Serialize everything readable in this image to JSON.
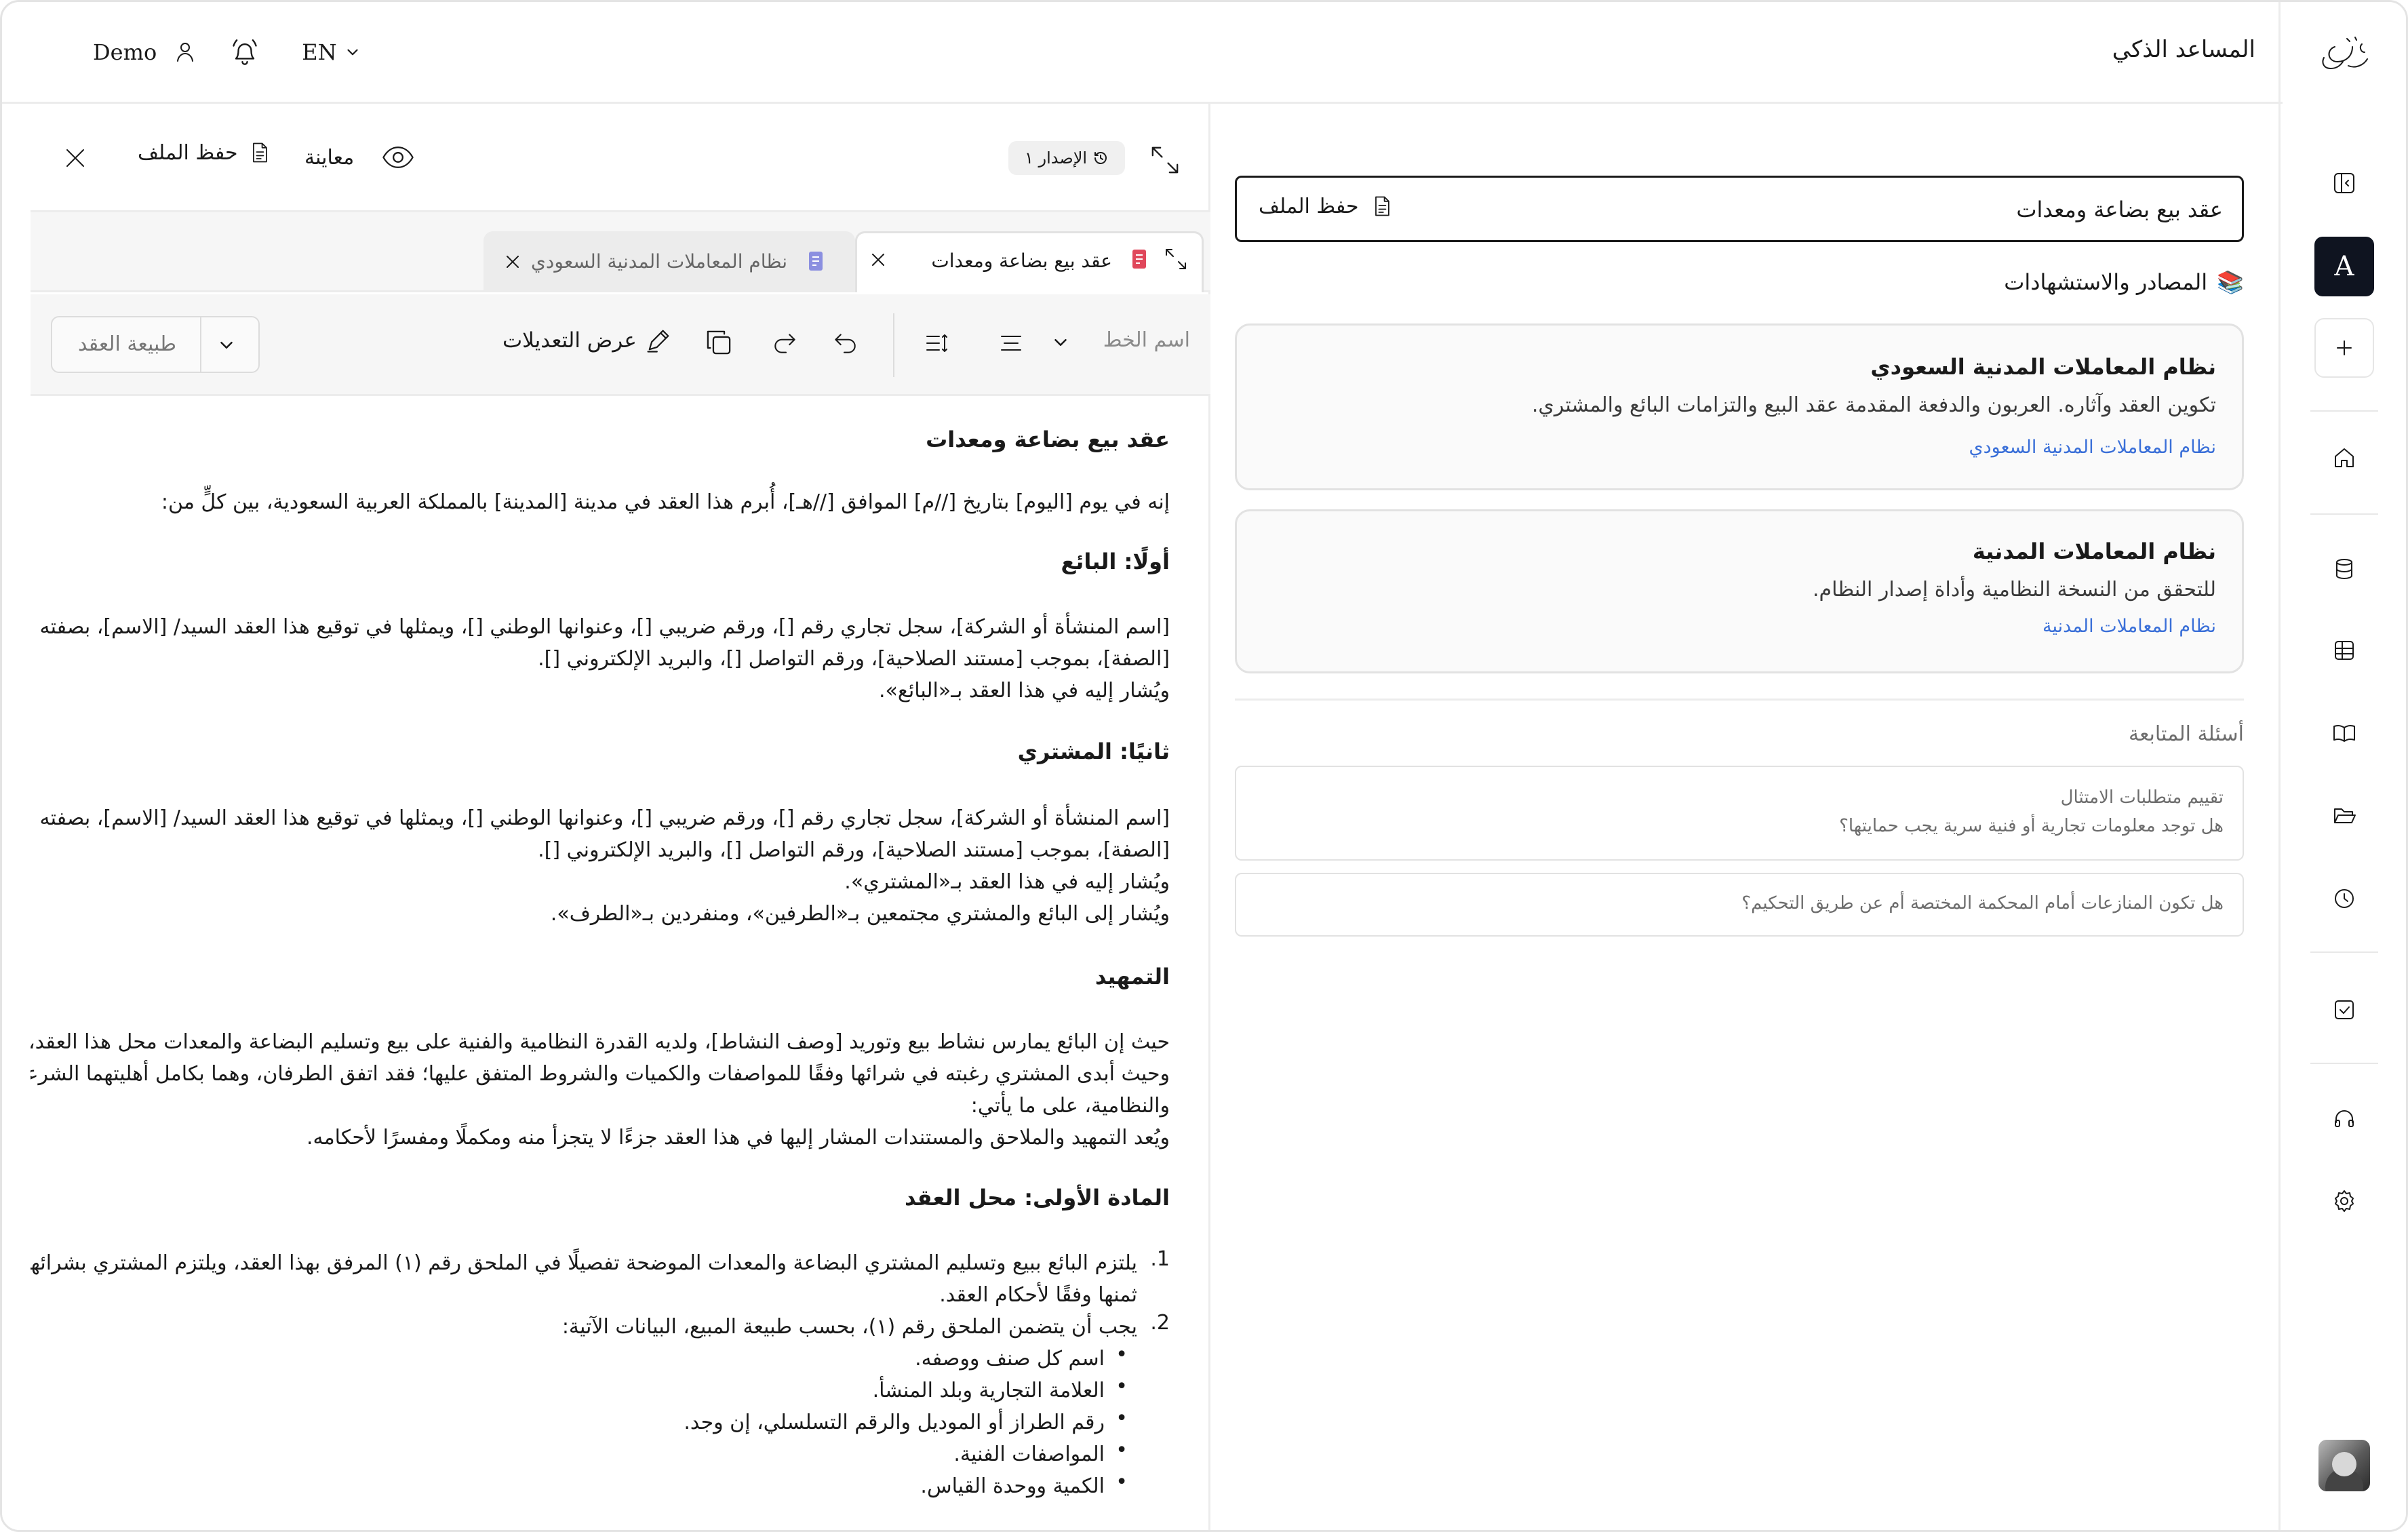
{
  "header": {
    "app_title": "المساعد الذكي",
    "user_name": "Demo",
    "language": "EN"
  },
  "sidebar": {
    "account_initial": "A",
    "items": [
      "collapse-panel",
      "new-chat",
      "home",
      "database",
      "table",
      "library",
      "folder",
      "history",
      "tasks",
      "support",
      "settings"
    ]
  },
  "editor": {
    "version_label": "الإصدار ١",
    "preview_label": "معاينة",
    "save_label": "حفظ الملف",
    "tabs": [
      {
        "label": "عقد بيع بضاعة ومعدات",
        "active": true
      },
      {
        "label": "نظام المعاملات المدنية السعودي",
        "active": false
      }
    ],
    "toolbar": {
      "font_placeholder": "اسم الخط",
      "show_changes_label": "عرض التعديلات",
      "contract_nature_label": "طبيعة العقد"
    },
    "document": {
      "title": "عقد بيع بضاعة ومعدات",
      "intro": "إنه في يوم [اليوم] بتاريخ [//م] الموافق [//هـ]، أُبرم هذا العقد في مدينة [المدينة] بالمملكة العربية السعودية، بين كلٍّ من:",
      "seller_heading": "أولًا: البائع",
      "seller_lines": [
        "[اسم المنشأة أو الشركة]، سجل تجاري رقم []، ورقم ضريبي []، وعنوانها الوطني []، ويمثلها في توقيع هذا العقد السيد/ [الاسم]، بصفته",
        "[الصفة]، بموجب [مستند الصلاحية]، ورقم التواصل []، والبريد الإلكتروني [].",
        "ويُشار إليه في هذا العقد بـ«البائع»."
      ],
      "buyer_heading": "ثانيًا: المشتري",
      "buyer_lines": [
        "[اسم المنشأة أو الشركة]، سجل تجاري رقم []، ورقم ضريبي []، وعنوانها الوطني []، ويمثلها في توقيع هذا العقد السيد/ [الاسم]، بصفته",
        "[الصفة]، بموجب [مستند الصلاحية]، ورقم التواصل []، والبريد الإلكتروني [].",
        "ويُشار إليه في هذا العقد بـ«المشتري».",
        "ويُشار إلى البائع والمشتري مجتمعين بـ«الطرفين»، ومنفردين بـ«الطرف»."
      ],
      "preamble_heading": "التمهيد",
      "preamble_lines": [
        "حيث إن البائع يمارس نشاط بيع وتوريد [وصف النشاط]، ولديه القدرة النظامية والفنية على بيع وتسليم البضاعة والمعدات محل هذا العقد،",
        "وحيث أبدى المشتري رغبته في شرائها وفقًا للمواصفات والكميات والشروط المتفق عليها؛ فقد اتفق الطرفان، وهما بكامل أهليتهما الشرعية",
        "والنظامية، على ما يأتي:",
        "ويُعد التمهيد والملاحق والمستندات المشار إليها في هذا العقد جزءًا لا يتجزأ منه ومكملًا ومفسرًا لأحكامه."
      ],
      "article1_heading": "المادة الأولى: محل العقد",
      "article1_item1_lines": [
        "يلتزم البائع ببيع وتسليم المشتري البضاعة والمعدات الموضحة تفصيلًا في الملحق رقم (١) المرفق بهذا العقد، ويلتزم المشتري بشرائها وسداد",
        "ثمنها وفقًا لأحكام العقد."
      ],
      "article1_item2": "يجب أن يتضمن الملحق رقم (١)، بحسب طبيعة المبيع، البيانات الآتية:",
      "article1_bullets": [
        "اسم كل صنف ووصفه.",
        "العلامة التجارية وبلد المنشأ.",
        "رقم الطراز أو الموديل والرقم التسلسلي، إن وجد.",
        "المواصفات الفنية.",
        "الكمية ووحدة القياس."
      ]
    }
  },
  "chat": {
    "file_title": "عقد بيع بضاعة ومعدات",
    "save_label": "حفظ الملف",
    "sources_heading": "المصادر والاستشهادات",
    "sources": [
      {
        "title": "نظام المعاملات المدنية السعودي",
        "body": "تكوين العقد وآثاره. العربون والدفعة المقدمة عقد البيع والتزامات البائع والمشتري.",
        "link": "نظام المعاملات المدنية السعودي"
      },
      {
        "title": "نظام المعاملات المدنية",
        "body": "للتحقق من النسخة النظامية وأداة إصدار النظام.",
        "link": "نظام المعاملات المدنية"
      }
    ],
    "followup_heading": "أسئلة المتابعة",
    "followups": [
      {
        "lines": [
          "تقييم متطلبات الامتثال",
          "هل توجد معلومات تجارية أو فنية سرية يجب حمايتها؟"
        ]
      },
      {
        "lines": [
          "هل تكون المنازعات أمام المحكمة المختصة أم عن طريق التحكيم؟"
        ]
      }
    ]
  }
}
